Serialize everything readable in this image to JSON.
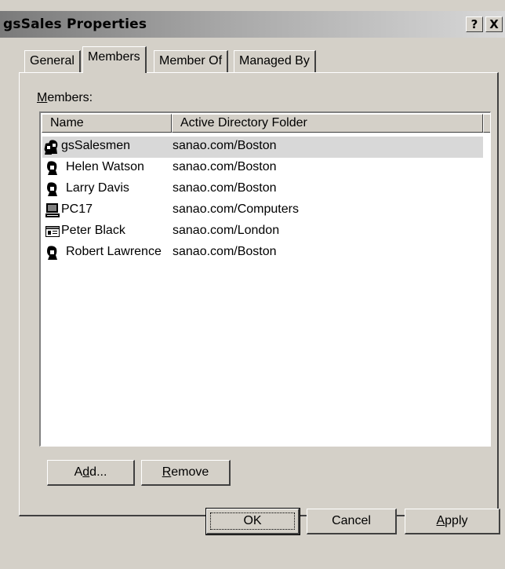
{
  "window": {
    "title": "gsSales Properties",
    "help_label": "?",
    "close_label": "X"
  },
  "tabs": [
    {
      "label": "General",
      "active": false
    },
    {
      "label": "Members",
      "active": true
    },
    {
      "label": "Member Of",
      "active": false
    },
    {
      "label": "Managed By",
      "active": false
    }
  ],
  "members": {
    "label_mnemonic": "M",
    "label_rest": "embers:",
    "columns": [
      "Name",
      "Active Directory Folder"
    ],
    "rows": [
      {
        "name": "gsSalesmen",
        "folder": "sanao.com/Boston",
        "icon": "group-icon",
        "selected": true
      },
      {
        "name": "Helen Watson",
        "folder": "sanao.com/Boston",
        "icon": "user-icon",
        "selected": false
      },
      {
        "name": "Larry Davis",
        "folder": "sanao.com/Boston",
        "icon": "user-icon",
        "selected": false
      },
      {
        "name": "PC17",
        "folder": "sanao.com/Computers",
        "icon": "computer-icon",
        "selected": false
      },
      {
        "name": "Peter Black",
        "folder": "sanao.com/London",
        "icon": "contact-icon",
        "selected": false
      },
      {
        "name": "Robert Lawrence",
        "folder": "sanao.com/Boston",
        "icon": "user-icon",
        "selected": false
      }
    ]
  },
  "buttons": {
    "add": {
      "pre": "A",
      "mnemonic": "d",
      "post": "d..."
    },
    "remove": {
      "pre": "",
      "mnemonic": "R",
      "post": "emove"
    },
    "ok": {
      "label": "OK"
    },
    "cancel": {
      "label": "Cancel"
    },
    "apply": {
      "pre": "",
      "mnemonic": "A",
      "post": "pply"
    }
  }
}
